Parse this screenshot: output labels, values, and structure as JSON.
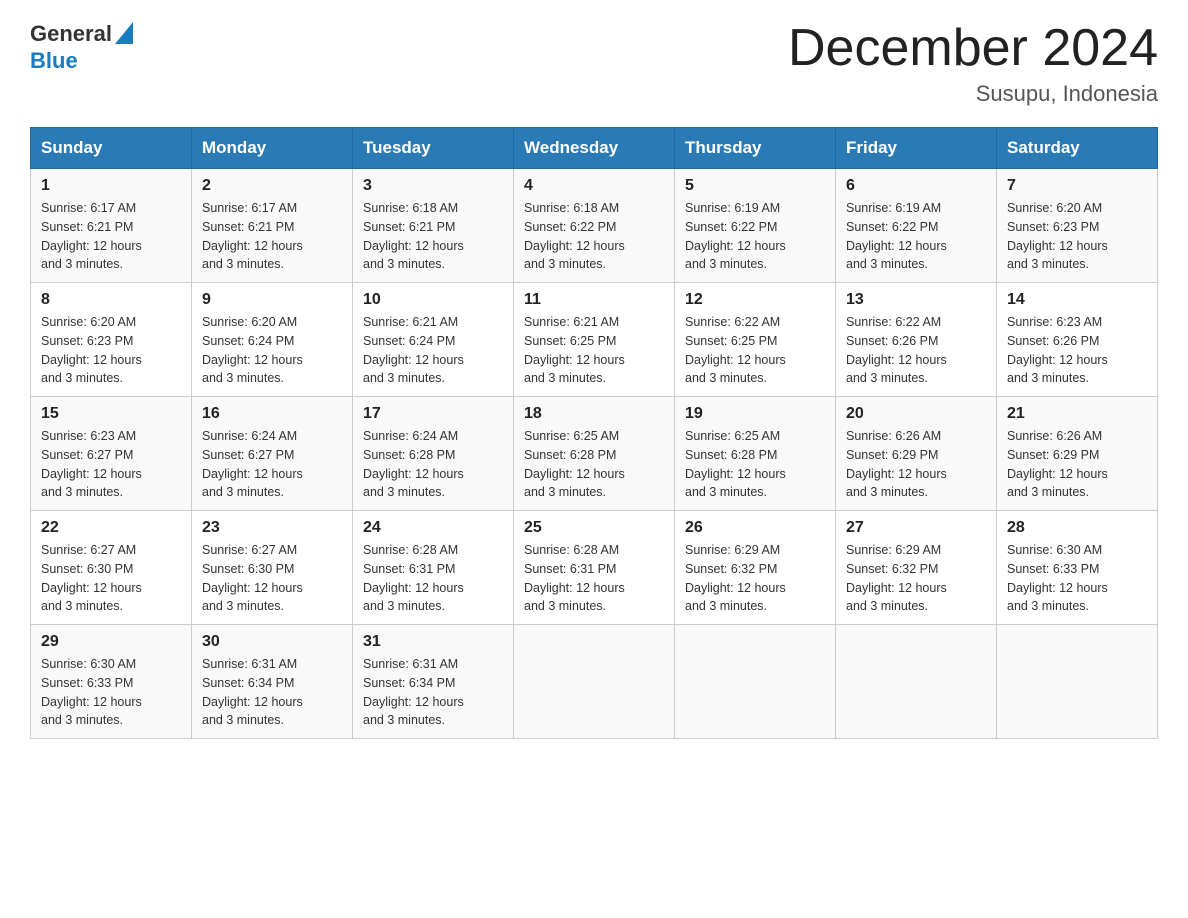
{
  "header": {
    "logo_general": "General",
    "logo_blue": "Blue",
    "title": "December 2024",
    "subtitle": "Susupu, Indonesia"
  },
  "days": [
    "Sunday",
    "Monday",
    "Tuesday",
    "Wednesday",
    "Thursday",
    "Friday",
    "Saturday"
  ],
  "weeks": [
    [
      {
        "day": "1",
        "sunrise": "6:17 AM",
        "sunset": "6:21 PM",
        "daylight": "12 hours and 3 minutes."
      },
      {
        "day": "2",
        "sunrise": "6:17 AM",
        "sunset": "6:21 PM",
        "daylight": "12 hours and 3 minutes."
      },
      {
        "day": "3",
        "sunrise": "6:18 AM",
        "sunset": "6:21 PM",
        "daylight": "12 hours and 3 minutes."
      },
      {
        "day": "4",
        "sunrise": "6:18 AM",
        "sunset": "6:22 PM",
        "daylight": "12 hours and 3 minutes."
      },
      {
        "day": "5",
        "sunrise": "6:19 AM",
        "sunset": "6:22 PM",
        "daylight": "12 hours and 3 minutes."
      },
      {
        "day": "6",
        "sunrise": "6:19 AM",
        "sunset": "6:22 PM",
        "daylight": "12 hours and 3 minutes."
      },
      {
        "day": "7",
        "sunrise": "6:20 AM",
        "sunset": "6:23 PM",
        "daylight": "12 hours and 3 minutes."
      }
    ],
    [
      {
        "day": "8",
        "sunrise": "6:20 AM",
        "sunset": "6:23 PM",
        "daylight": "12 hours and 3 minutes."
      },
      {
        "day": "9",
        "sunrise": "6:20 AM",
        "sunset": "6:24 PM",
        "daylight": "12 hours and 3 minutes."
      },
      {
        "day": "10",
        "sunrise": "6:21 AM",
        "sunset": "6:24 PM",
        "daylight": "12 hours and 3 minutes."
      },
      {
        "day": "11",
        "sunrise": "6:21 AM",
        "sunset": "6:25 PM",
        "daylight": "12 hours and 3 minutes."
      },
      {
        "day": "12",
        "sunrise": "6:22 AM",
        "sunset": "6:25 PM",
        "daylight": "12 hours and 3 minutes."
      },
      {
        "day": "13",
        "sunrise": "6:22 AM",
        "sunset": "6:26 PM",
        "daylight": "12 hours and 3 minutes."
      },
      {
        "day": "14",
        "sunrise": "6:23 AM",
        "sunset": "6:26 PM",
        "daylight": "12 hours and 3 minutes."
      }
    ],
    [
      {
        "day": "15",
        "sunrise": "6:23 AM",
        "sunset": "6:27 PM",
        "daylight": "12 hours and 3 minutes."
      },
      {
        "day": "16",
        "sunrise": "6:24 AM",
        "sunset": "6:27 PM",
        "daylight": "12 hours and 3 minutes."
      },
      {
        "day": "17",
        "sunrise": "6:24 AM",
        "sunset": "6:28 PM",
        "daylight": "12 hours and 3 minutes."
      },
      {
        "day": "18",
        "sunrise": "6:25 AM",
        "sunset": "6:28 PM",
        "daylight": "12 hours and 3 minutes."
      },
      {
        "day": "19",
        "sunrise": "6:25 AM",
        "sunset": "6:28 PM",
        "daylight": "12 hours and 3 minutes."
      },
      {
        "day": "20",
        "sunrise": "6:26 AM",
        "sunset": "6:29 PM",
        "daylight": "12 hours and 3 minutes."
      },
      {
        "day": "21",
        "sunrise": "6:26 AM",
        "sunset": "6:29 PM",
        "daylight": "12 hours and 3 minutes."
      }
    ],
    [
      {
        "day": "22",
        "sunrise": "6:27 AM",
        "sunset": "6:30 PM",
        "daylight": "12 hours and 3 minutes."
      },
      {
        "day": "23",
        "sunrise": "6:27 AM",
        "sunset": "6:30 PM",
        "daylight": "12 hours and 3 minutes."
      },
      {
        "day": "24",
        "sunrise": "6:28 AM",
        "sunset": "6:31 PM",
        "daylight": "12 hours and 3 minutes."
      },
      {
        "day": "25",
        "sunrise": "6:28 AM",
        "sunset": "6:31 PM",
        "daylight": "12 hours and 3 minutes."
      },
      {
        "day": "26",
        "sunrise": "6:29 AM",
        "sunset": "6:32 PM",
        "daylight": "12 hours and 3 minutes."
      },
      {
        "day": "27",
        "sunrise": "6:29 AM",
        "sunset": "6:32 PM",
        "daylight": "12 hours and 3 minutes."
      },
      {
        "day": "28",
        "sunrise": "6:30 AM",
        "sunset": "6:33 PM",
        "daylight": "12 hours and 3 minutes."
      }
    ],
    [
      {
        "day": "29",
        "sunrise": "6:30 AM",
        "sunset": "6:33 PM",
        "daylight": "12 hours and 3 minutes."
      },
      {
        "day": "30",
        "sunrise": "6:31 AM",
        "sunset": "6:34 PM",
        "daylight": "12 hours and 3 minutes."
      },
      {
        "day": "31",
        "sunrise": "6:31 AM",
        "sunset": "6:34 PM",
        "daylight": "12 hours and 3 minutes."
      },
      null,
      null,
      null,
      null
    ]
  ],
  "labels": {
    "sunrise": "Sunrise:",
    "sunset": "Sunset:",
    "daylight": "Daylight:"
  }
}
